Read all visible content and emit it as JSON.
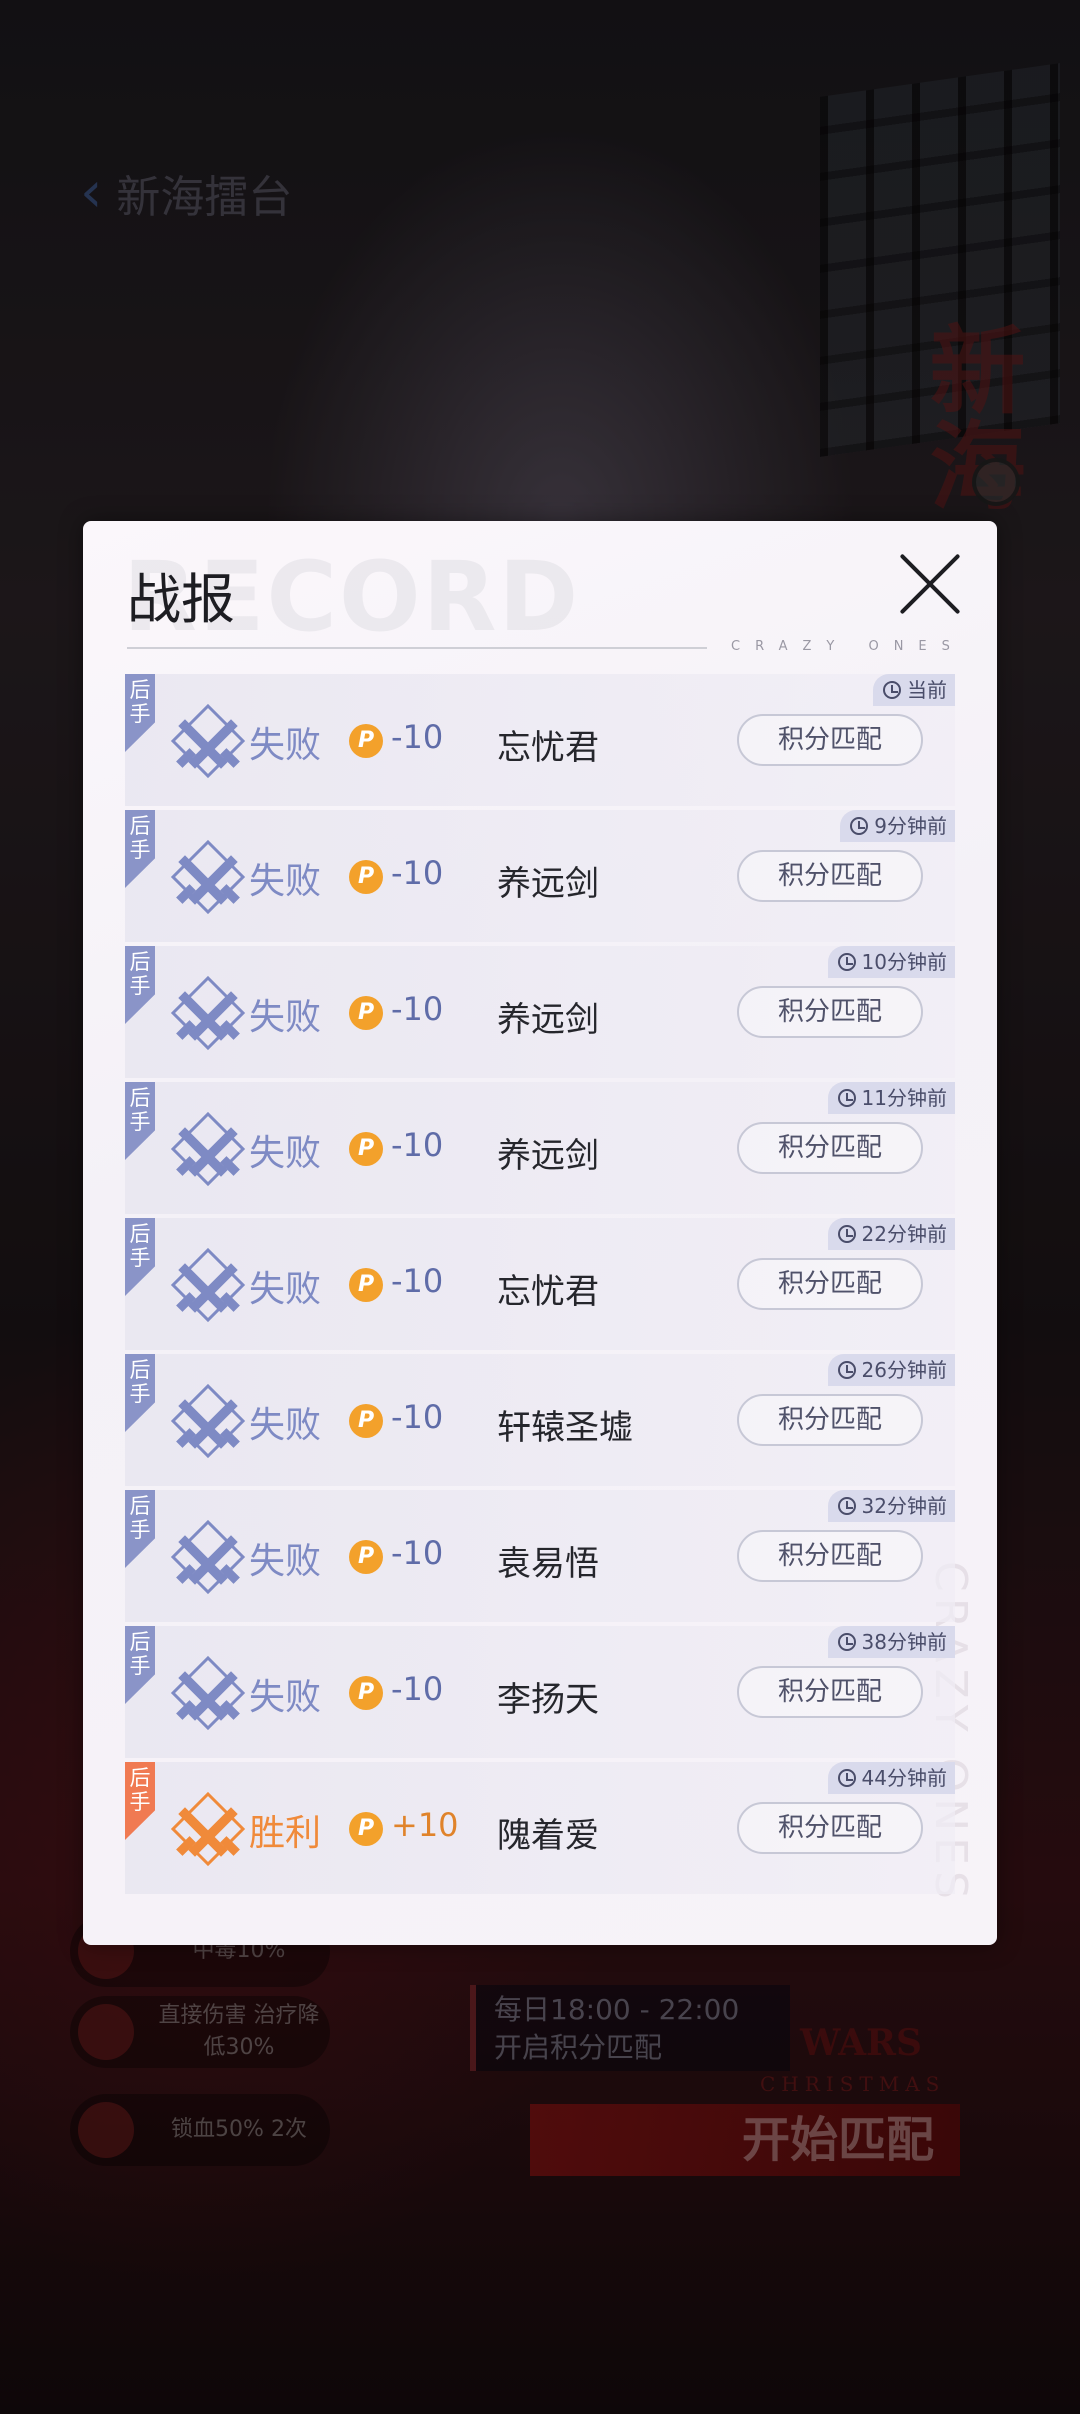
{
  "background": {
    "page_title": "新海擂台",
    "vertical_text": "新海",
    "stats": [
      {
        "text": "中毒10%"
      },
      {
        "text": "直接伤害 治疗降低30%"
      },
      {
        "text": "锁血50% 2次"
      }
    ],
    "schedule_line1": "每日18:00 - 22:00",
    "schedule_line2": "开启积分匹配",
    "wars_text": "WARS",
    "christmas_text": "CHRISTMAS",
    "start_button": "开始匹配"
  },
  "dialog": {
    "title": "战报",
    "watermark": "RECORD",
    "tagline": "CRAZY ONES",
    "side_watermark": "CRAZY ONES",
    "close_icon": "close-icon"
  },
  "records": [
    {
      "badge": "后手",
      "result": "失败",
      "delta": "-10",
      "opponent": "忘忧君",
      "time": "当前",
      "button": "积分匹配",
      "win": false
    },
    {
      "badge": "后手",
      "result": "失败",
      "delta": "-10",
      "opponent": "养远剑",
      "time": "9分钟前",
      "button": "积分匹配",
      "win": false
    },
    {
      "badge": "后手",
      "result": "失败",
      "delta": "-10",
      "opponent": "养远剑",
      "time": "10分钟前",
      "button": "积分匹配",
      "win": false
    },
    {
      "badge": "后手",
      "result": "失败",
      "delta": "-10",
      "opponent": "养远剑",
      "time": "11分钟前",
      "button": "积分匹配",
      "win": false
    },
    {
      "badge": "后手",
      "result": "失败",
      "delta": "-10",
      "opponent": "忘忧君",
      "time": "22分钟前",
      "button": "积分匹配",
      "win": false
    },
    {
      "badge": "后手",
      "result": "失败",
      "delta": "-10",
      "opponent": "轩辕圣墟",
      "time": "26分钟前",
      "button": "积分匹配",
      "win": false
    },
    {
      "badge": "后手",
      "result": "失败",
      "delta": "-10",
      "opponent": "袁易悟",
      "time": "32分钟前",
      "button": "积分匹配",
      "win": false
    },
    {
      "badge": "后手",
      "result": "失败",
      "delta": "-10",
      "opponent": "李扬天",
      "time": "38分钟前",
      "button": "积分匹配",
      "win": false
    },
    {
      "badge": "后手",
      "result": "胜利",
      "delta": "+10",
      "opponent": "隗着爱",
      "time": "44分钟前",
      "button": "积分匹配",
      "win": true
    }
  ],
  "colors": {
    "loss": "#7e8ac4",
    "win": "#f08a3a",
    "coin": "#f3a12b"
  },
  "coin_symbol": "P"
}
